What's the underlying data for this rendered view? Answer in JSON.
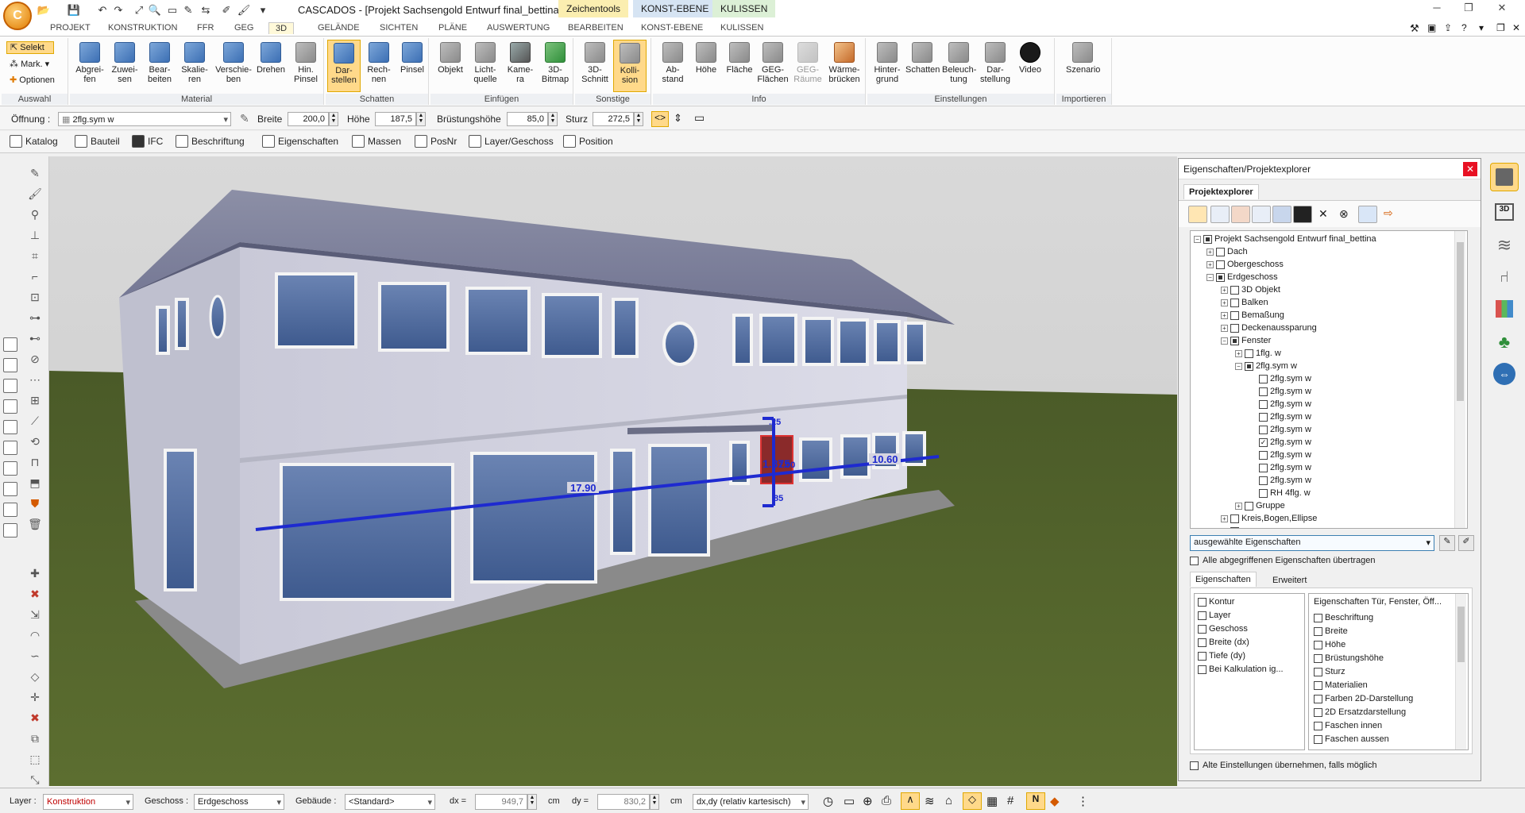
{
  "app": {
    "logo": "C",
    "title": "CASCADOS - [Projekt Sachsengold Entwurf final_bettina]",
    "context_tabs": [
      "Zeichentools",
      "KONST-EBENE",
      "KULISSEN"
    ]
  },
  "ribbon_tabs": [
    "PROJEKT",
    "KONSTRUKTION",
    "FFR",
    "GEG",
    "3D",
    "GELÄNDE",
    "SICHTEN",
    "PLÄNE",
    "AUSWERTUNG",
    "BEARBEITEN",
    "KONST-EBENE",
    "KULISSEN"
  ],
  "active_tab": "3D",
  "ribbon": {
    "auswahl": {
      "title": "Auswahl",
      "items": [
        "Selekt",
        "Mark.",
        "Optionen"
      ]
    },
    "material": {
      "title": "Material",
      "buttons": [
        "Abgrei-\nfen",
        "Zuwei-\nsen",
        "Bear-\nbeiten",
        "Skalie-\nren",
        "Verschie-\nben",
        "Drehen",
        "Hin.\nPinsel"
      ]
    },
    "schatten": {
      "title": "Schatten",
      "buttons": [
        "Dar-\nstellen",
        "Rech-\nnen",
        "Pinsel"
      ]
    },
    "einfuegen": {
      "title": "Einfügen",
      "buttons": [
        "Objekt",
        "Licht-\nquelle",
        "Kame-\nra",
        "3D-\nBitmap"
      ]
    },
    "sonstige": {
      "title": "Sonstige",
      "buttons": [
        "3D-\nSchnitt",
        "Kolli-\nsion"
      ]
    },
    "info": {
      "title": "Info",
      "buttons": [
        "Ab-\nstand",
        "Höhe",
        "Fläche",
        "GEG-\nFlächen",
        "GEG-\nRäume",
        "Wärme-\nbrücken"
      ]
    },
    "einstellungen": {
      "title": "Einstellungen",
      "buttons": [
        "Hinter-\ngrund",
        "Schatten",
        "Beleuch-\ntung",
        "Dar-\nstellung",
        "Video"
      ]
    },
    "importieren": {
      "title": "Importieren",
      "buttons": [
        "Szenario"
      ]
    }
  },
  "opening_bar": {
    "label": "Öffnung :",
    "value": "2flg.sym w",
    "breite_label": "Breite",
    "breite": "200,0",
    "hoehe_label": "Höhe",
    "hoehe": "187,5",
    "bruest_label": "Brüstungshöhe",
    "bruest": "85,0",
    "sturz_label": "Sturz",
    "sturz": "272,5"
  },
  "toolbar2": [
    "Katalog",
    "Bauteil",
    "IFC",
    "Beschriftung",
    "Eigenschaften",
    "Massen",
    "PosNr",
    "Layer/Geschoss",
    "Position"
  ],
  "viewport": {
    "dimensions": [
      "17.90",
      "10.60",
      "1.875",
      "2.00",
      "85",
      ".25"
    ]
  },
  "panel": {
    "title": "Eigenschaften/Projektexplorer",
    "tab": "Projektexplorer",
    "tree": [
      "Projekt Sachsengold Entwurf final_bettina",
      "Dach",
      "Obergeschoss",
      "Erdgeschoss",
      "3D Objekt",
      "Balken",
      "Bemaßung",
      "Deckenaussparung",
      "Fenster",
      "1flg. w",
      "2flg.sym w",
      "2flg.sym w",
      "2flg.sym w",
      "2flg.sym w",
      "2flg.sym w",
      "2flg.sym w",
      "2flg.sym w",
      "2flg.sym w",
      "2flg.sym w",
      "2flg.sym w",
      "RH 4flg. w",
      "Gruppe",
      "Kreis,Bogen,Ellipse"
    ],
    "dropdown": "ausgewählte Eigenschaften",
    "transfer_all": "Alle abgegriffenen Eigenschaften übertragen",
    "subtabs": [
      "Eigenschaften",
      "Erweitert"
    ],
    "left_list": [
      "Kontur",
      "Layer",
      "Geschoss",
      "Breite (dx)",
      "Tiefe (dy)",
      "Bei Kalkulation ig..."
    ],
    "right_title": "Eigenschaften Tür, Fenster, Öff...",
    "right_list": [
      "Beschriftung",
      "Breite",
      "Höhe",
      "Brüstungshöhe",
      "Sturz",
      "Materialien",
      "Farben 2D-Darstellung",
      "2D Ersatzdarstellung",
      "Faschen innen",
      "Faschen aussen"
    ],
    "keep_settings": "Alte Einstellungen übernehmen, falls möglich"
  },
  "statusbar": {
    "layer_label": "Layer :",
    "layer": "Konstruktion",
    "geschoss_label": "Geschoss :",
    "geschoss": "Erdgeschoss",
    "gebaeude_label": "Gebäude :",
    "gebaeude": "<Standard>",
    "dx_label": "dx =",
    "dx": "949,7",
    "dy_label": "dy =",
    "dy": "830,2",
    "unit": "cm",
    "mode": "dx,dy (relativ kartesisch)"
  }
}
